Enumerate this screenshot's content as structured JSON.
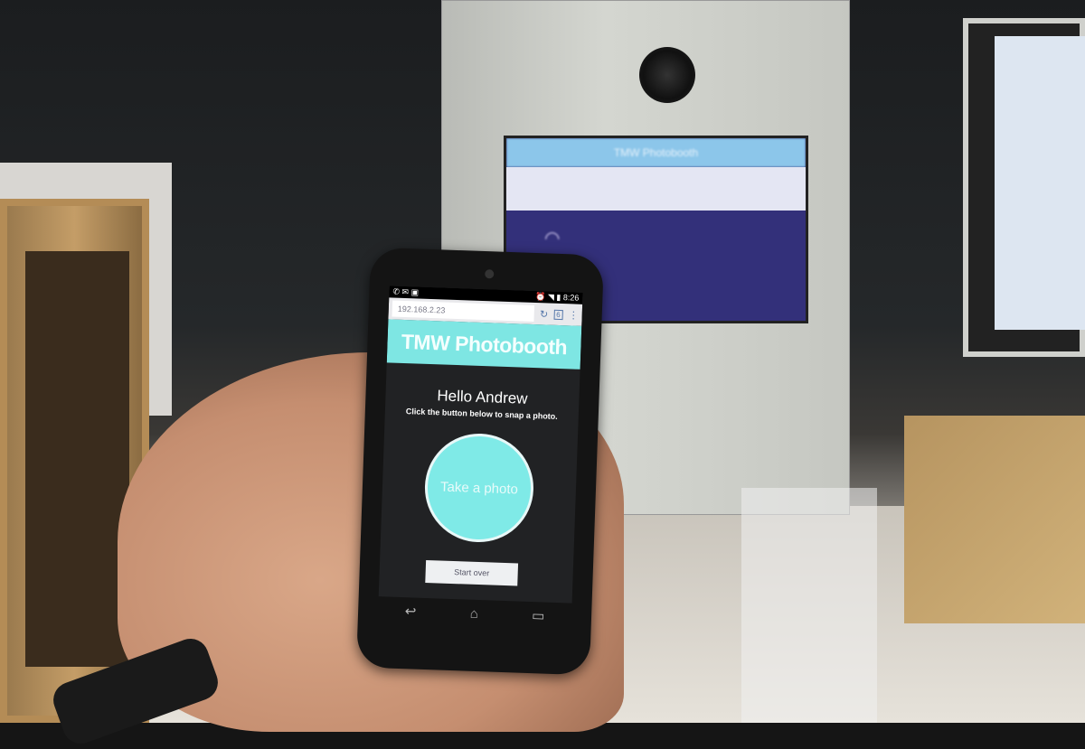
{
  "phone": {
    "status_time": "8:26",
    "url": "192.168.2.23",
    "tab_count": "6",
    "app_title": "TMW Photobooth",
    "greeting": "Hello Andrew",
    "instruction": "Click the button below to snap a photo.",
    "take_photo_label": "Take a photo",
    "start_over_label": "Start over",
    "icons": [
      "whatsapp-icon",
      "mail-icon",
      "briefcase-icon",
      "alarm-icon",
      "wifi-icon",
      "signal-icon",
      "battery-icon",
      "reload-icon",
      "tabs-icon",
      "menu-icon",
      "back-icon",
      "home-icon",
      "recents-icon"
    ]
  },
  "monitor": {
    "title": "TMW Photobooth"
  },
  "colors": {
    "app_bar": "#7ee6e3",
    "button": "#7feae7",
    "monitor_bg": "#33307a"
  }
}
